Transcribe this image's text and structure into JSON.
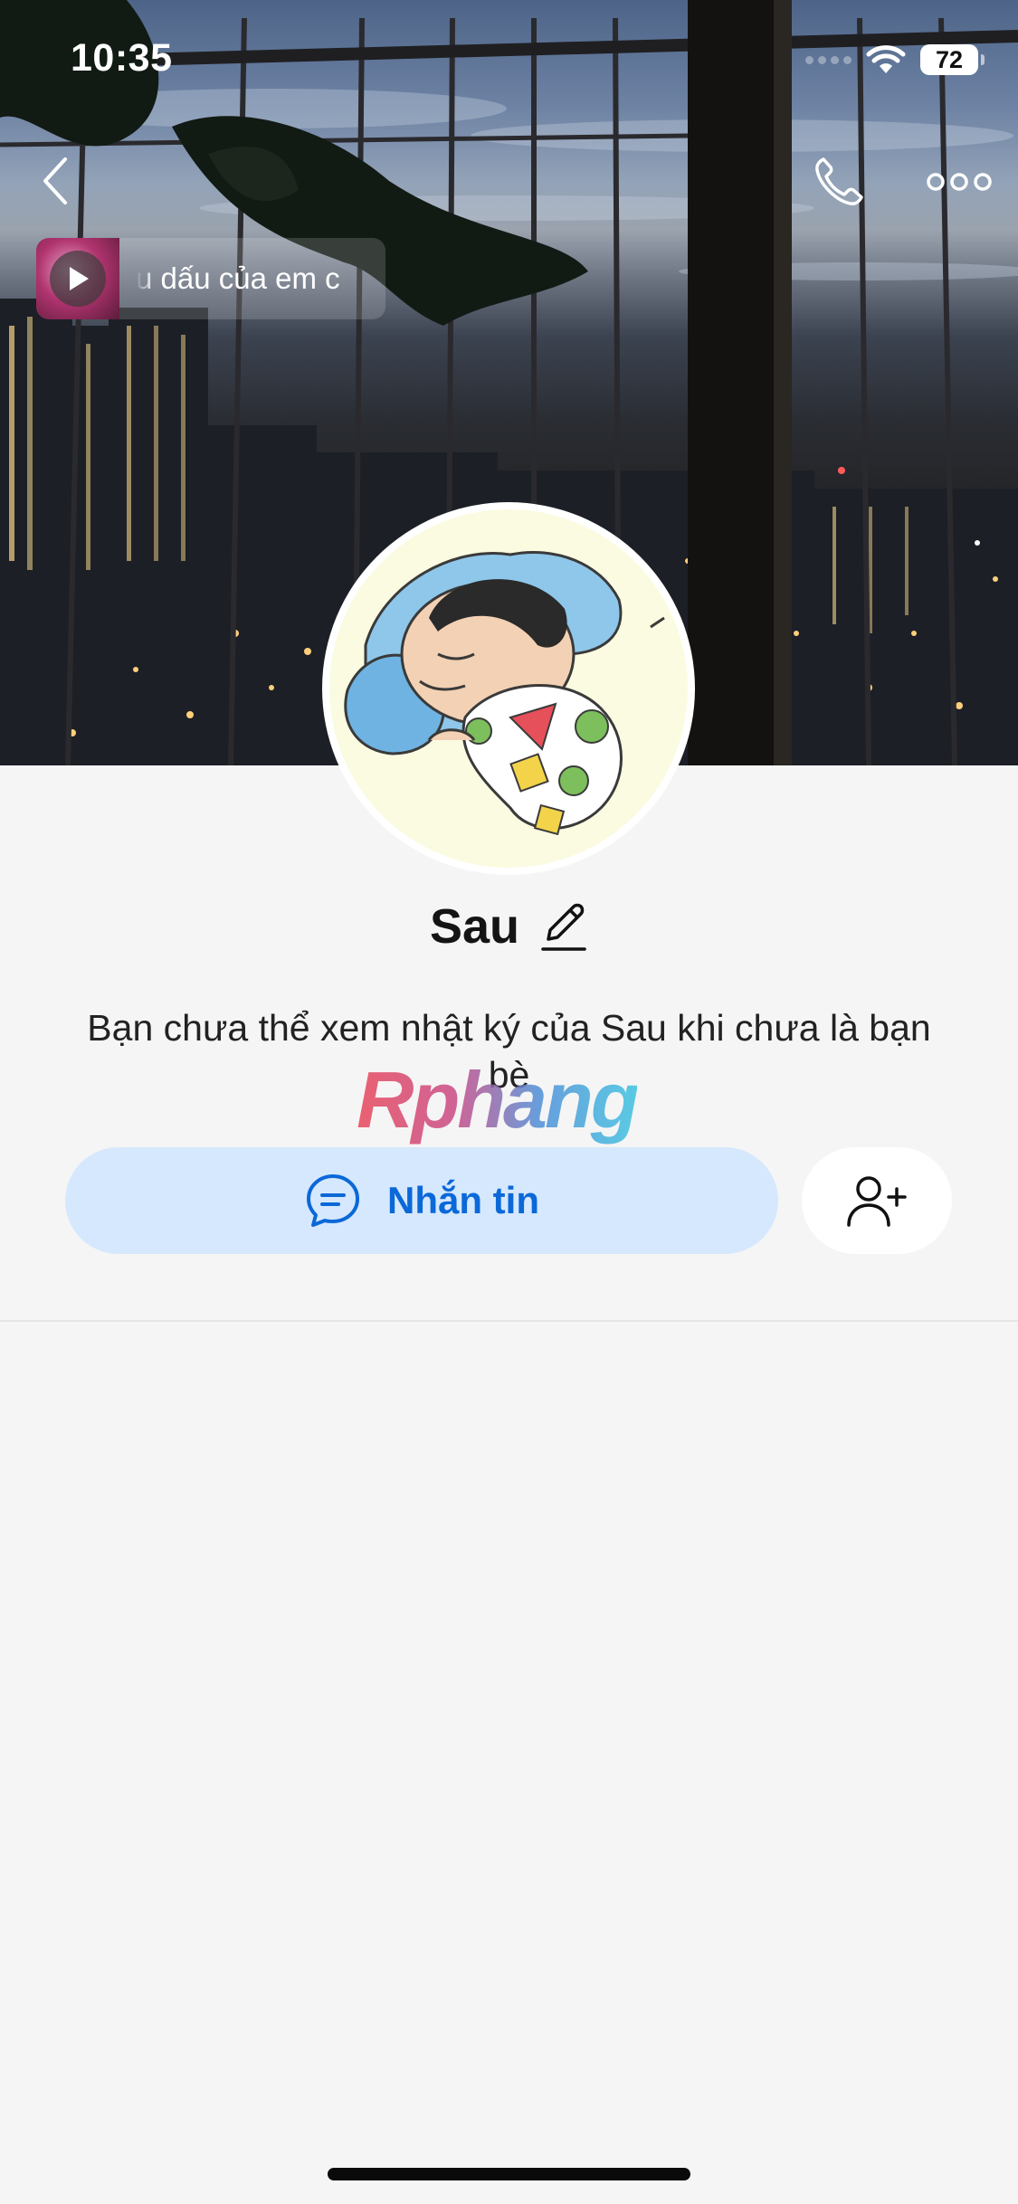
{
  "status_bar": {
    "time": "10:35",
    "battery": "72"
  },
  "top_bar": {
    "back_icon": "chevron-left-icon",
    "call_icon": "phone-icon",
    "more_icon": "more-horizontal-icon"
  },
  "music": {
    "play_icon": "play-icon",
    "song_text": "u dấu của em c"
  },
  "profile": {
    "name": "Sau",
    "edit_icon": "pencil-icon",
    "privacy_message": "Bạn chưa thể xem nhật ký của Sau khi chưa là bạn bè"
  },
  "watermark": {
    "text": "Rphang"
  },
  "actions": {
    "message_label": "Nhắn tin",
    "message_icon": "chat-bubble-icon",
    "add_friend_icon": "user-plus-icon"
  },
  "colors": {
    "accent": "#0b68d8",
    "button_bg": "#d6e8fd",
    "page_bg": "#f5f5f5"
  }
}
